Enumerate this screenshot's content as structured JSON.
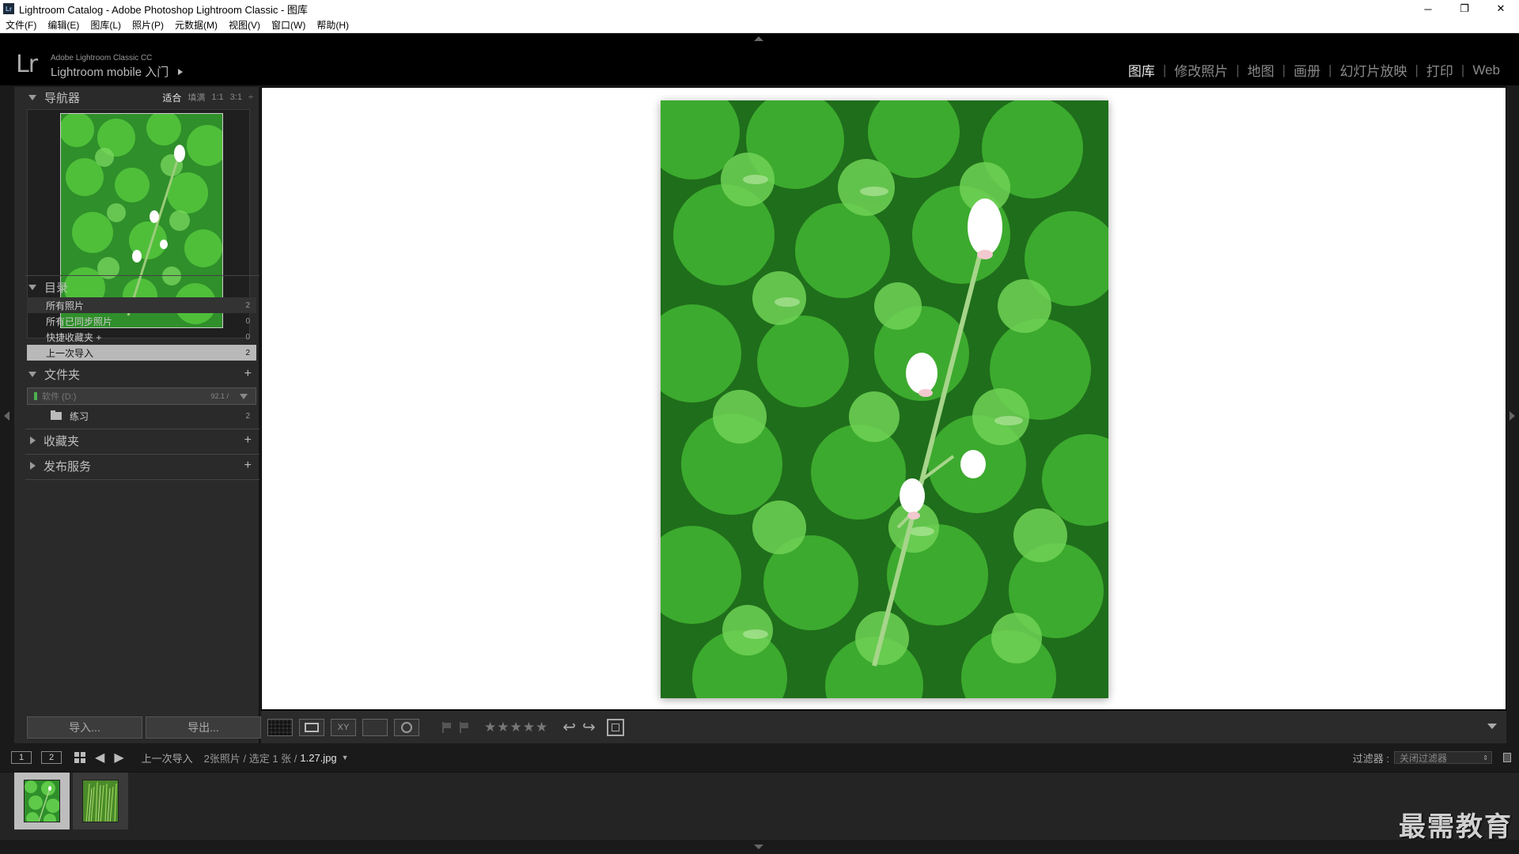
{
  "window": {
    "title": "Lightroom Catalog - Adobe Photoshop Lightroom Classic - 图库",
    "app_badge": "Lr",
    "controls": {
      "minimize": "─",
      "restore": "❐",
      "close": "✕"
    }
  },
  "menu": [
    "文件(F)",
    "编辑(E)",
    "图库(L)",
    "照片(P)",
    "元数据(M)",
    "视图(V)",
    "窗口(W)",
    "帮助(H)"
  ],
  "identity": {
    "logo": "Lr",
    "product": "Adobe Lightroom Classic CC",
    "mobile_label": "Lightroom mobile 入门"
  },
  "modules": [
    "图库",
    "修改照片",
    "地图",
    "画册",
    "幻灯片放映",
    "打印",
    "Web"
  ],
  "module_separator": "|",
  "navigator": {
    "title": "导航器",
    "zoom": [
      "适合",
      "填满",
      "1:1",
      "3:1"
    ],
    "zoom_more": "÷"
  },
  "catalog": {
    "title": "目录",
    "items": [
      {
        "label": "所有照片",
        "count": "2"
      },
      {
        "label": "所有已同步照片",
        "count": "0"
      },
      {
        "label": "快捷收藏夹 +",
        "count": "0"
      },
      {
        "label": "上一次导入",
        "count": "2"
      }
    ]
  },
  "folders": {
    "title": "文件夹",
    "plus": "+",
    "volume": {
      "name": "软件 (D:)",
      "space": "92.1 / "
    },
    "items": [
      {
        "label": "练习",
        "count": "2"
      }
    ]
  },
  "collections": {
    "title": "收藏夹",
    "plus": "+"
  },
  "publish": {
    "title": "发布服务",
    "plus": "+"
  },
  "buttons": {
    "import": "导入...",
    "export": "导出..."
  },
  "toolbar": {
    "compare_label": "XY",
    "stars": "★★★★★",
    "rotate_left": "↩",
    "rotate_right": "↪"
  },
  "filmstrip_bar": {
    "screen1": "1",
    "screen2": "2",
    "prev": "◀",
    "next": "▶",
    "source": "上一次导入",
    "count_text": "2张照片 / 选定 1 张 /",
    "file": "1.27.jpg",
    "caret": "▼",
    "filter_label": "过滤器 :",
    "filter_value": "关闭过滤器",
    "filter_spin": "⇕"
  },
  "watermark": "最需教育"
}
